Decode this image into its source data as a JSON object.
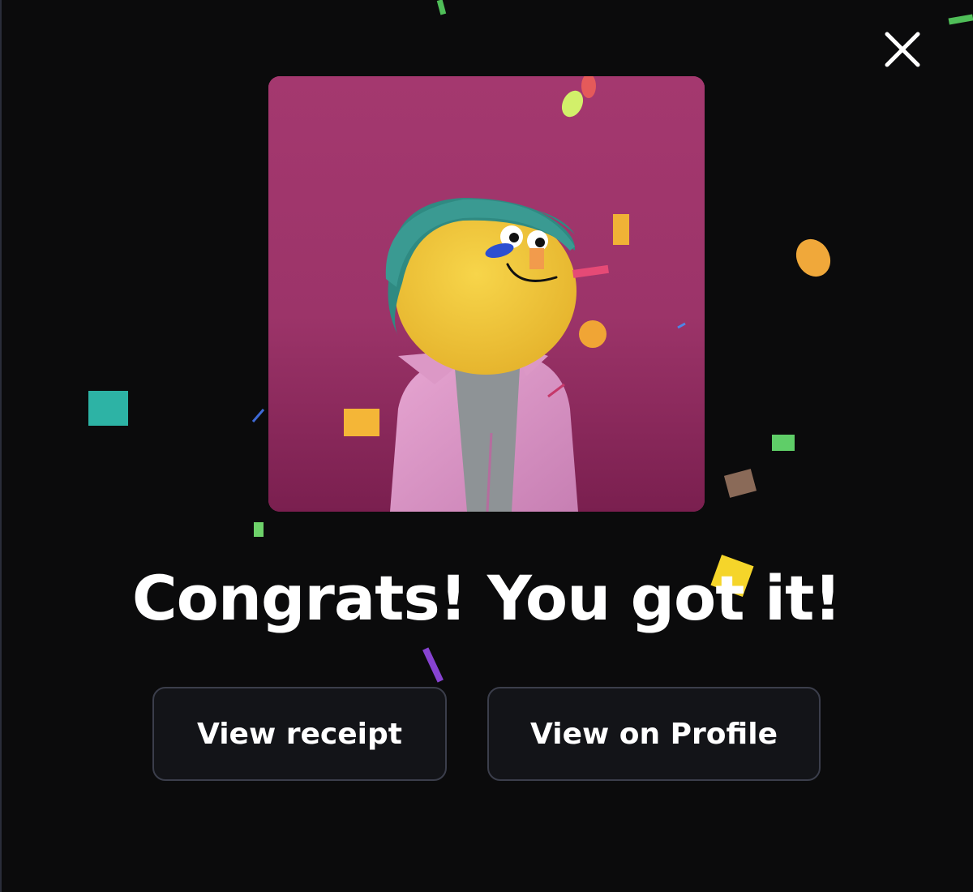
{
  "modal": {
    "headline": "Congrats! You got it!",
    "close_icon": "close-icon"
  },
  "nft": {
    "image_subject": "yellow clay character wearing a teal knit beanie and a pink jacket",
    "background_color": "#a0376c"
  },
  "actions": {
    "view_receipt_label": "View receipt",
    "view_on_profile_label": "View on Profile"
  },
  "colors": {
    "page_background": "#0b0b0c",
    "button_background": "#131418",
    "button_border": "#3b3e4b",
    "text": "#ffffff"
  }
}
